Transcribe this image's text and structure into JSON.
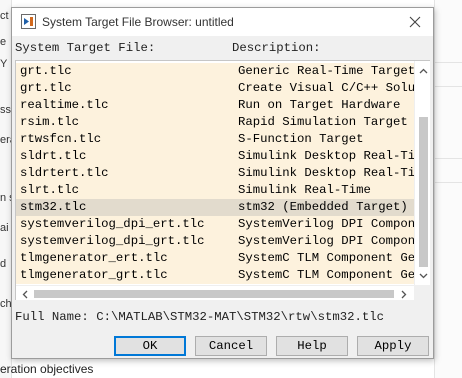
{
  "background": {
    "left_fragments": [
      "ct",
      "e",
      "Y",
      "ss",
      "era",
      "n s",
      "ai",
      "d",
      "ch"
    ],
    "caption": "eration objectives"
  },
  "dialog": {
    "title": "System Target File Browser: untitled",
    "headers": {
      "file": "System Target File:",
      "description": "Description:"
    },
    "rows": [
      {
        "file": "grt.tlc",
        "description": "Generic Real-Time Target"
      },
      {
        "file": "grt.tlc",
        "description": "Create Visual C/C++ Solution"
      },
      {
        "file": "realtime.tlc",
        "description": "Run on Target Hardware"
      },
      {
        "file": "rsim.tlc",
        "description": "Rapid Simulation Target"
      },
      {
        "file": "rtwsfcn.tlc",
        "description": "S-Function Target"
      },
      {
        "file": "sldrt.tlc",
        "description": "Simulink Desktop Real-Time"
      },
      {
        "file": "sldrtert.tlc",
        "description": "Simulink Desktop Real-Time"
      },
      {
        "file": "slrt.tlc",
        "description": "Simulink Real-Time"
      },
      {
        "file": "stm32.tlc",
        "description": "stm32 (Embedded Target)"
      },
      {
        "file": "systemverilog_dpi_ert.tlc",
        "description": "SystemVerilog DPI Component"
      },
      {
        "file": "systemverilog_dpi_grt.tlc",
        "description": "SystemVerilog DPI Component"
      },
      {
        "file": "tlmgenerator_ert.tlc",
        "description": "SystemC TLM Component Generator"
      },
      {
        "file": "tlmgenerator_grt.tlc",
        "description": "SystemC TLM Component Generator"
      }
    ],
    "selected_index": 8,
    "full_name_label": "Full Name:",
    "full_name_value": "C:\\MATLAB\\STM32-MAT\\STM32\\rtw\\stm32.tlc",
    "buttons": {
      "ok": "OK",
      "cancel": "Cancel",
      "help": "Help",
      "apply": "Apply"
    }
  },
  "colors": {
    "row_bg": "#fdf2dd",
    "row_selected_bg": "#e2dbcd",
    "default_button_border": "#0078d7"
  }
}
